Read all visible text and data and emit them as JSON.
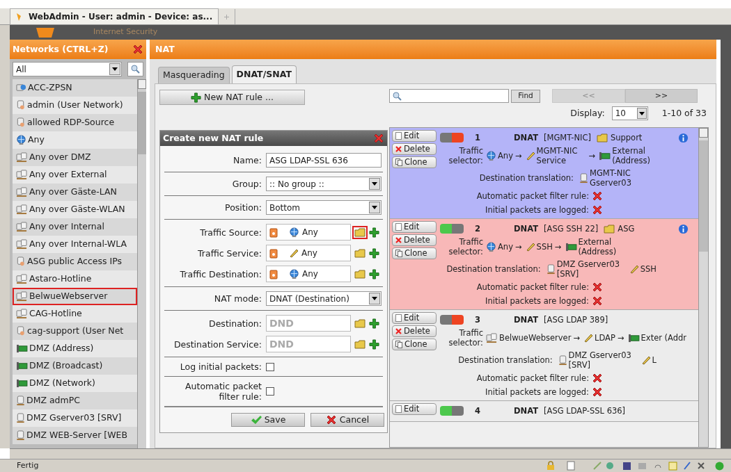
{
  "browser_tab": {
    "title": "WebAdmin - User: admin - Device: as..."
  },
  "header": {
    "brand_text": "Internet Security"
  },
  "sidebar": {
    "title": "Networks (CTRL+Z)",
    "filter": "All",
    "items": [
      {
        "label": "ACC-ZPSN",
        "kind": "network",
        "highlighted": false
      },
      {
        "label": "admin (User Network)",
        "kind": "user",
        "highlighted": false
      },
      {
        "label": "allowed RDP-Source",
        "kind": "user",
        "highlighted": false
      },
      {
        "label": "Any",
        "kind": "any",
        "highlighted": false
      },
      {
        "label": "Any over DMZ",
        "kind": "group",
        "highlighted": false
      },
      {
        "label": "Any over External",
        "kind": "group",
        "highlighted": false
      },
      {
        "label": "Any over Gäste-LAN",
        "kind": "group",
        "highlighted": false
      },
      {
        "label": "Any over Gäste-WLAN",
        "kind": "group",
        "highlighted": false
      },
      {
        "label": "Any over Internal",
        "kind": "group",
        "highlighted": false
      },
      {
        "label": "Any over Internal-WLA",
        "kind": "group",
        "highlighted": false
      },
      {
        "label": "ASG public Access IPs",
        "kind": "user",
        "highlighted": false
      },
      {
        "label": "Astaro-Hotline",
        "kind": "group",
        "highlighted": false
      },
      {
        "label": "BelwueWebserver",
        "kind": "group",
        "highlighted": true
      },
      {
        "label": "CAG-Hotline",
        "kind": "group",
        "highlighted": false
      },
      {
        "label": "cag-support (User Net",
        "kind": "user",
        "highlighted": false
      },
      {
        "label": "DMZ (Address)",
        "kind": "interface",
        "highlighted": false
      },
      {
        "label": "DMZ (Broadcast)",
        "kind": "interface",
        "highlighted": false
      },
      {
        "label": "DMZ (Network)",
        "kind": "interface",
        "highlighted": false
      },
      {
        "label": "DMZ admPC",
        "kind": "host",
        "highlighted": false
      },
      {
        "label": "DMZ Gserver03 [SRV]",
        "kind": "host",
        "highlighted": false
      },
      {
        "label": "DMZ WEB-Server [WEB",
        "kind": "host",
        "highlighted": false
      }
    ]
  },
  "main": {
    "title": "NAT",
    "tabs": [
      {
        "label": "Masquerading",
        "selected": false
      },
      {
        "label": "DNAT/SNAT",
        "selected": true
      }
    ],
    "new_rule_button": "New NAT rule ...",
    "find_button": "Find",
    "pager": {
      "prev": "<<",
      "next": ">>"
    },
    "display": {
      "label": "Display:",
      "value": "10"
    },
    "range": "1-10 of 33"
  },
  "dialog": {
    "title": "Create new NAT rule",
    "sections": [
      [
        {
          "kind": "text",
          "label": "Name:",
          "value": "ASG LDAP-SSL 636"
        }
      ],
      [
        {
          "kind": "select",
          "label": "Group:",
          "value": ":: No group ::"
        }
      ],
      [
        {
          "kind": "select",
          "label": "Position:",
          "value": "Bottom"
        }
      ],
      [
        {
          "kind": "object",
          "label": "Traffic Source:",
          "object": {
            "label": "Any",
            "kind": "any"
          },
          "highlighted": true
        },
        {
          "kind": "object",
          "label": "Traffic Service:",
          "object": {
            "label": "Any",
            "kind": "service"
          },
          "highlighted": false
        },
        {
          "kind": "object",
          "label": "Traffic Destination:",
          "object": {
            "label": "Any",
            "kind": "any"
          },
          "highlighted": false
        }
      ],
      [
        {
          "kind": "select",
          "label": "NAT mode:",
          "value": "DNAT (Destination)"
        }
      ],
      [
        {
          "kind": "object",
          "label": "Destination:",
          "placeholder": "DND",
          "highlighted": false
        },
        {
          "kind": "object",
          "label": "Destination Service:",
          "placeholder": "DND",
          "highlighted": false
        }
      ],
      [
        {
          "kind": "checkbox",
          "label": "Log initial packets:",
          "checked": false
        }
      ],
      [
        {
          "kind": "checkbox",
          "label": "Automatic packet filter rule:",
          "checked": false
        }
      ]
    ],
    "save_button": "Save",
    "cancel_button": "Cancel"
  },
  "rules": [
    {
      "number": "1",
      "enabled": false,
      "color": "#b4b4f8",
      "type": "DNAT",
      "name": "[MGMT-NIC]",
      "group": "Support",
      "info": true,
      "buttons": [
        "Edit",
        "Delete",
        "Clone"
      ],
      "selector_label": "Traffic selector:",
      "arrows": [
        "→",
        "→"
      ],
      "selector": [
        {
          "label": "Any",
          "kind": "any"
        },
        {
          "label": "MGMT-NIC Service",
          "kind": "service"
        },
        {
          "label": "External (Address)",
          "kind": "interface"
        }
      ],
      "translation_label": "Destination translation:",
      "translation": [
        {
          "label": "MGMT-NIC Gserver03",
          "kind": "host"
        }
      ],
      "auto_filter_label": "Automatic packet filter rule:",
      "auto_filter": false,
      "logged_label": "Initial packets are logged:",
      "logged": false
    },
    {
      "number": "2",
      "enabled": true,
      "color": "#f8b8b8",
      "type": "DNAT",
      "name": "[ASG SSH 22]",
      "group": "ASG",
      "info": true,
      "buttons": [
        "Edit",
        "Delete",
        "Clone"
      ],
      "selector_label": "Traffic selector:",
      "arrows": [
        "→",
        "→"
      ],
      "selector": [
        {
          "label": "Any",
          "kind": "any"
        },
        {
          "label": "SSH",
          "kind": "service"
        },
        {
          "label": "External (Address)",
          "kind": "interface"
        }
      ],
      "translation_label": "Destination translation:",
      "translation": [
        {
          "label": "DMZ Gserver03 [SRV]",
          "kind": "host"
        },
        {
          "label": "SSH",
          "kind": "service"
        }
      ],
      "auto_filter_label": "Automatic packet filter rule:",
      "auto_filter": false,
      "logged_label": "Initial packets are logged:",
      "logged": false
    },
    {
      "number": "3",
      "enabled": false,
      "color": "#ececec",
      "type": "DNAT",
      "name": "[ASG LDAP 389]",
      "info": false,
      "buttons": [
        "Edit",
        "Delete",
        "Clone"
      ],
      "selector_label": "Traffic selector:",
      "arrows": [
        "→",
        "→"
      ],
      "selector": [
        {
          "label": "BelwueWebserver",
          "kind": "group"
        },
        {
          "label": "LDAP",
          "kind": "service"
        },
        {
          "label": "Exter (Addr",
          "kind": "interface"
        }
      ],
      "translation_label": "Destination translation:",
      "translation": [
        {
          "label": "DMZ Gserver03 [SRV]",
          "kind": "host"
        },
        {
          "label": "L",
          "kind": "service"
        }
      ],
      "auto_filter_label": "Automatic packet filter rule:",
      "auto_filter": false,
      "logged_label": "Initial packets are logged:",
      "logged": false
    },
    {
      "number": "4",
      "enabled": true,
      "color": "#ececec",
      "type": "DNAT",
      "name": "[ASG LDAP-SSL 636]",
      "info": false,
      "buttons": [
        "Edit"
      ]
    }
  ],
  "status_bar": {
    "text": "Fertig"
  }
}
